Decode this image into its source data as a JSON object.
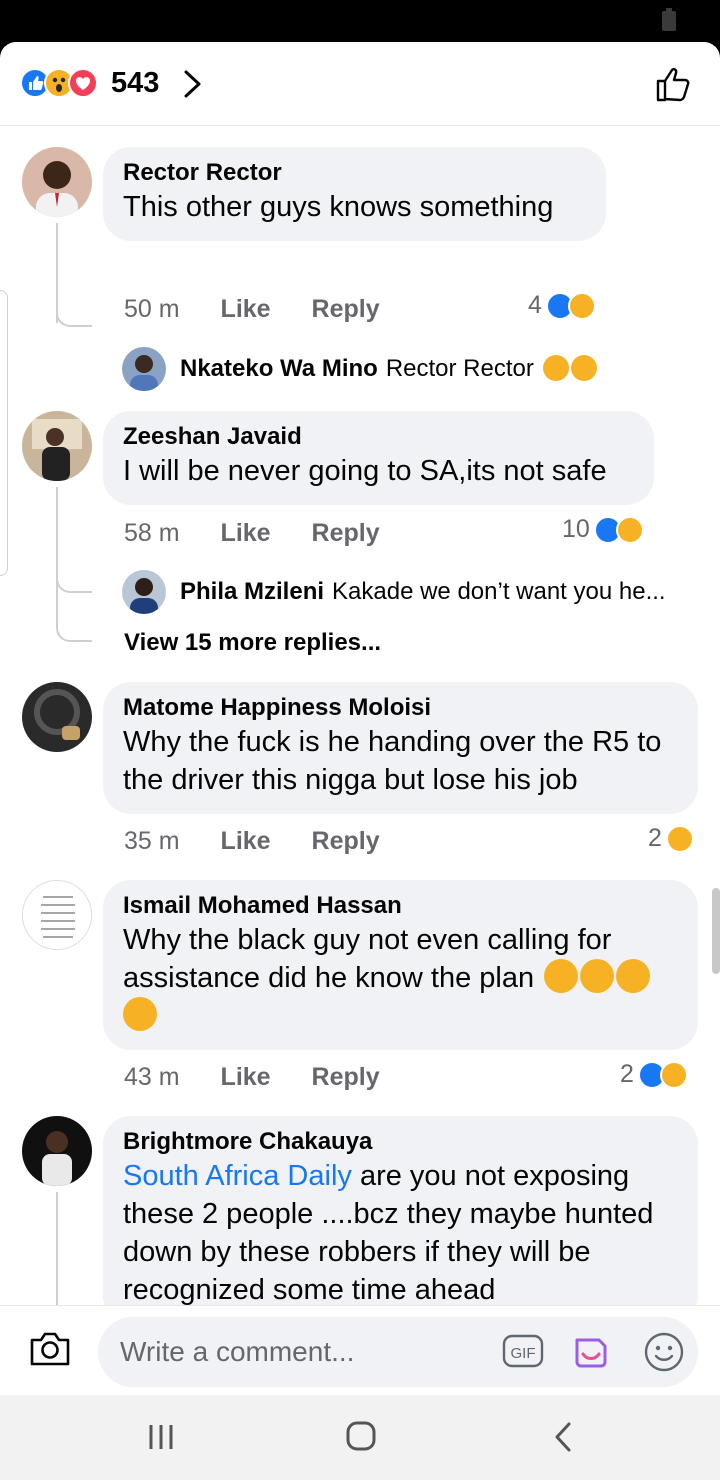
{
  "header": {
    "reaction_total": "543",
    "reaction_icons": [
      "like-icon",
      "wow-icon",
      "love-icon"
    ]
  },
  "comments": [
    {
      "author": "Rector Rector",
      "text": "This other guys knows something",
      "time": "50 m",
      "like": "Like",
      "reply": "Reply",
      "reaction_count": "4",
      "reply_preview": {
        "author": "Nkateko Wa Mino",
        "text": "Rector Rector"
      }
    },
    {
      "author": "Zeeshan Javaid",
      "text": "I will be never going to SA,its not safe",
      "time": "58 m",
      "like": "Like",
      "reply": "Reply",
      "reaction_count": "10",
      "reply_preview": {
        "author": "Phila Mzileni",
        "text": "Kakade we don’t want you he..."
      },
      "view_more": "View 15 more replies..."
    },
    {
      "author": "Matome Happiness Moloisi",
      "text_line1": "Why the fuck is he handing over the R5 to",
      "text_line2": "the driver this nigga but lose his job",
      "time": "35 m",
      "like": "Like",
      "reply": "Reply",
      "reaction_count": "2"
    },
    {
      "author": "Ismail Mohamed Hassan",
      "text_line1": "Why the black guy not even calling for",
      "text_line2": "assistance did he know the plan",
      "time": "43 m",
      "like": "Like",
      "reply": "Reply",
      "reaction_count": "2"
    },
    {
      "author": "Brightmore Chakauya",
      "mention": "South Africa Daily",
      "text_line1": " are you not exposing",
      "text_line2": "these 2 people ....bcz they maybe hunted",
      "text_line3": "down by these robbers if they  will be",
      "text_line4": "recognized some time ahead"
    }
  ],
  "composer": {
    "placeholder": "Write a comment..."
  },
  "colors": {
    "accent": "#1877f2",
    "bubble": "#f0f2f5",
    "meta_text": "#65676b"
  }
}
